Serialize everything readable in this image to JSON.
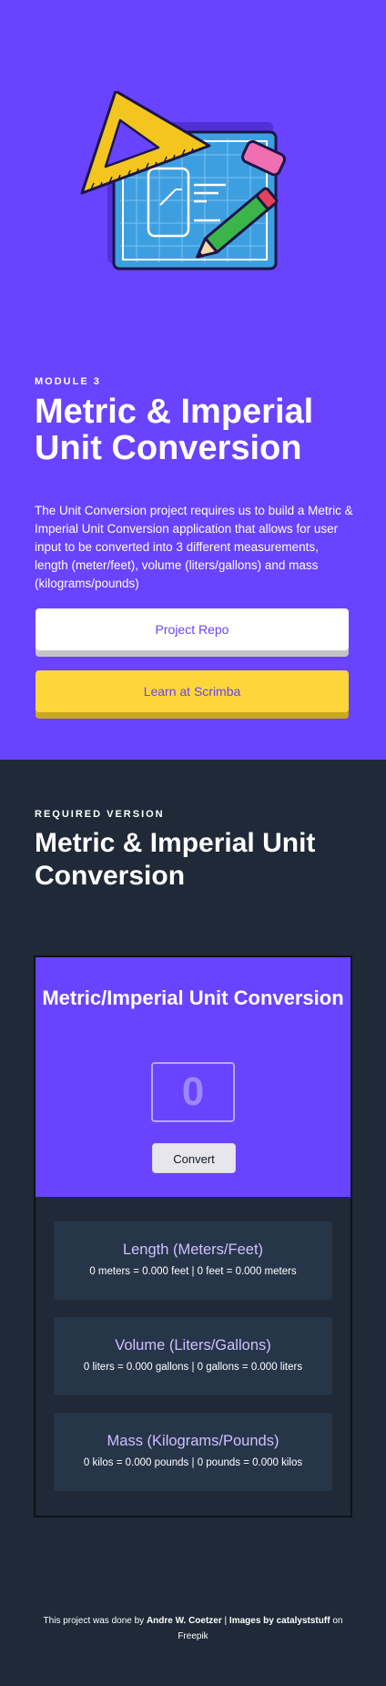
{
  "hero": {
    "kicker": "MODULE 3",
    "title": "Metric & Imperial Unit Conversion",
    "description": "The Unit Conversion project requires us to build a Metric & Imperial Unit Conversion application that allows for user input to be converted into 3 different measurements, length (meter/feet), volume (liters/gallons) and mass (kilograms/pounds)",
    "buttons": {
      "repo": "Project Repo",
      "scrimba": "Learn at Scrimba"
    }
  },
  "required": {
    "kicker": "REQUIRED VERSION",
    "title": "Metric & Imperial Unit Conversion"
  },
  "app": {
    "title": "Metric/Imperial Unit Conversion",
    "input_value": "0",
    "convert_label": "Convert",
    "cards": [
      {
        "title": "Length (Meters/Feet)",
        "text": "0 meters = 0.000 feet | 0 feet = 0.000 meters"
      },
      {
        "title": "Volume (Liters/Gallons)",
        "text": "0 liters = 0.000 gallons | 0 gallons = 0.000 liters"
      },
      {
        "title": "Mass (Kilograms/Pounds)",
        "text": "0 kilos = 0.000 pounds | 0 pounds = 0.000 kilos"
      }
    ]
  },
  "footer": {
    "prefix": "This project was done by",
    "author": "Andre W. Coetzer",
    "sep": "|",
    "images": "Images by catalyststuff",
    "on": "on",
    "source": "Freepik"
  },
  "colors": {
    "hero_bg": "#6943ff",
    "dark_bg": "#1f2937",
    "card_bg": "#273549",
    "accent_yellow": "#fdd73a",
    "card_title": "#cdc1ff"
  },
  "icons": {
    "hero_illustration": "blueprint-ruler-pencil-illustration"
  }
}
